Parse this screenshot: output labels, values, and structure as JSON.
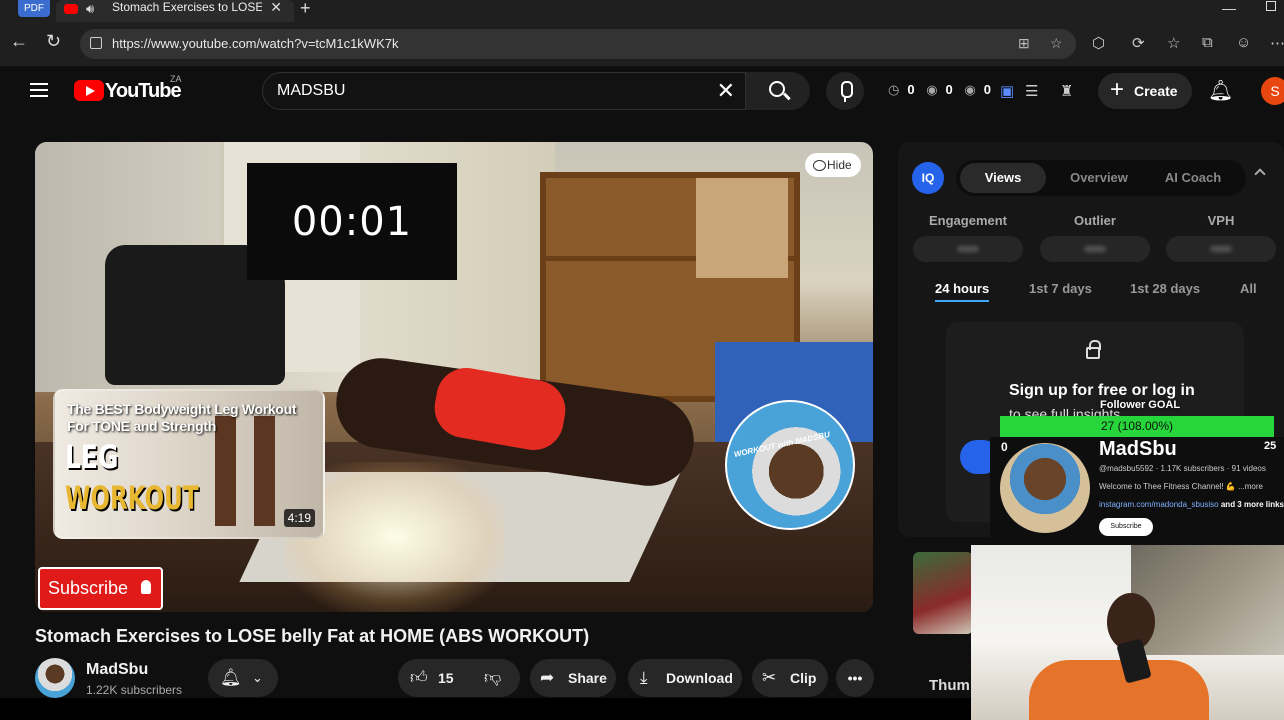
{
  "browser": {
    "pdf_chip": "PDF",
    "tab_title": "Stomach Exercises to LOSE b",
    "url": "https://www.youtube.com/watch?v=tcM1c1kWK7k"
  },
  "yt": {
    "logo_text": "YouTube",
    "country": "ZA",
    "search_query": "MADSBU",
    "stats": [
      "0",
      "0",
      "0"
    ],
    "create_label": "Create",
    "avatar_letter": "S"
  },
  "player": {
    "timer": "00:01",
    "hide_label": "Hide",
    "card_title": "The BEST Bodyweight Leg Workout For TONE and Strength",
    "card_big1": "LEG",
    "card_big2": "WORKOUT",
    "card_duration": "4:19",
    "circle_label": "WORKOUT with MADSBU",
    "subscribe_label": "Subscribe"
  },
  "video": {
    "title": "Stomach Exercises to LOSE belly Fat at HOME (ABS WORKOUT)",
    "channel": "MadSbu",
    "subscribers": "1.22K subscribers",
    "likes": "15",
    "share_label": "Share",
    "download_label": "Download",
    "clip_label": "Clip"
  },
  "panel": {
    "iq_label": "IQ",
    "tabs": [
      "Views",
      "Overview",
      "AI Coach"
    ],
    "metrics": [
      "Engagement",
      "Outlier",
      "VPH"
    ],
    "ranges": [
      "24 hours",
      "1st 7 days",
      "1st 28 days",
      "All"
    ],
    "signup": "Sign up for free or log in",
    "signup_ghost": "to see full insights"
  },
  "overlay": {
    "goal_title": "Follower GOAL",
    "goal_text": "27 (108.00%)",
    "goal_min": "0",
    "goal_max": "25",
    "name": "MadSbu",
    "meta": "@madsbu5592 · 1.17K subscribers · 91 videos",
    "desc": "Welcome to Thee Fitness Channel! 💪 ...more",
    "link": "instagram.com/madonda_sbusiso",
    "link_more": "and 3 more links",
    "subscribe": "Subscribe"
  },
  "sidebar_peek": "Thum"
}
